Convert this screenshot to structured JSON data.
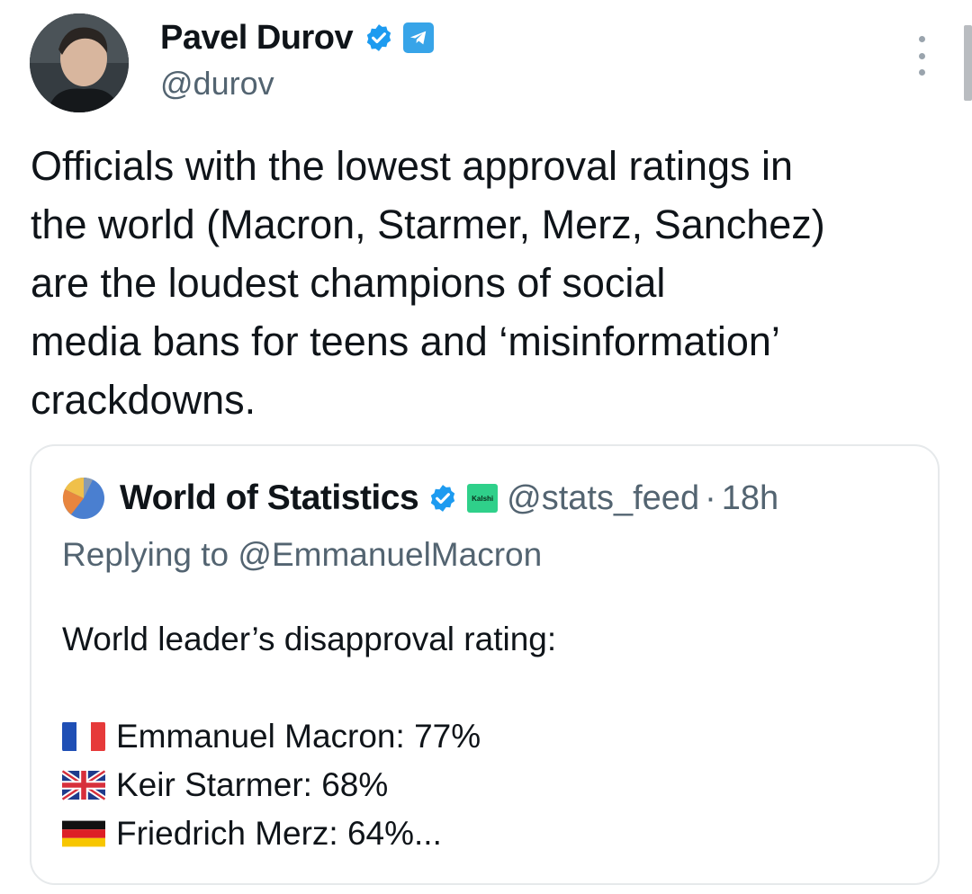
{
  "author": {
    "name": "Pavel Durov",
    "handle": "@durov"
  },
  "tweet": {
    "lines": [
      "Officials with the lowest approval ratings in",
      "the world (Macron, Starmer, Merz, Sanchez)",
      "are the loudest champions of social",
      "media bans for teens and ‘misinformation’",
      "crackdowns."
    ]
  },
  "quote": {
    "name": "World of Statistics",
    "badge_text": "Kalshi",
    "handle": "@stats_feed",
    "separator": "·",
    "time": "18h",
    "replying_to": "Replying to @EmmanuelMacron",
    "heading": "World leader’s disapproval rating:",
    "leaders": [
      {
        "flag": "flag-france-icon",
        "text": "Emmanuel Macron: 77%"
      },
      {
        "flag": "flag-uk-icon",
        "text": "Keir Starmer: 68%"
      },
      {
        "flag": "flag-germany-icon",
        "text": "Friedrich Merz: 64%..."
      }
    ]
  },
  "colors": {
    "verified": "#1d9bf0",
    "telegram": "#37a4e8",
    "secondary_text": "#536471",
    "kalshi_green": "#2fd08a"
  }
}
